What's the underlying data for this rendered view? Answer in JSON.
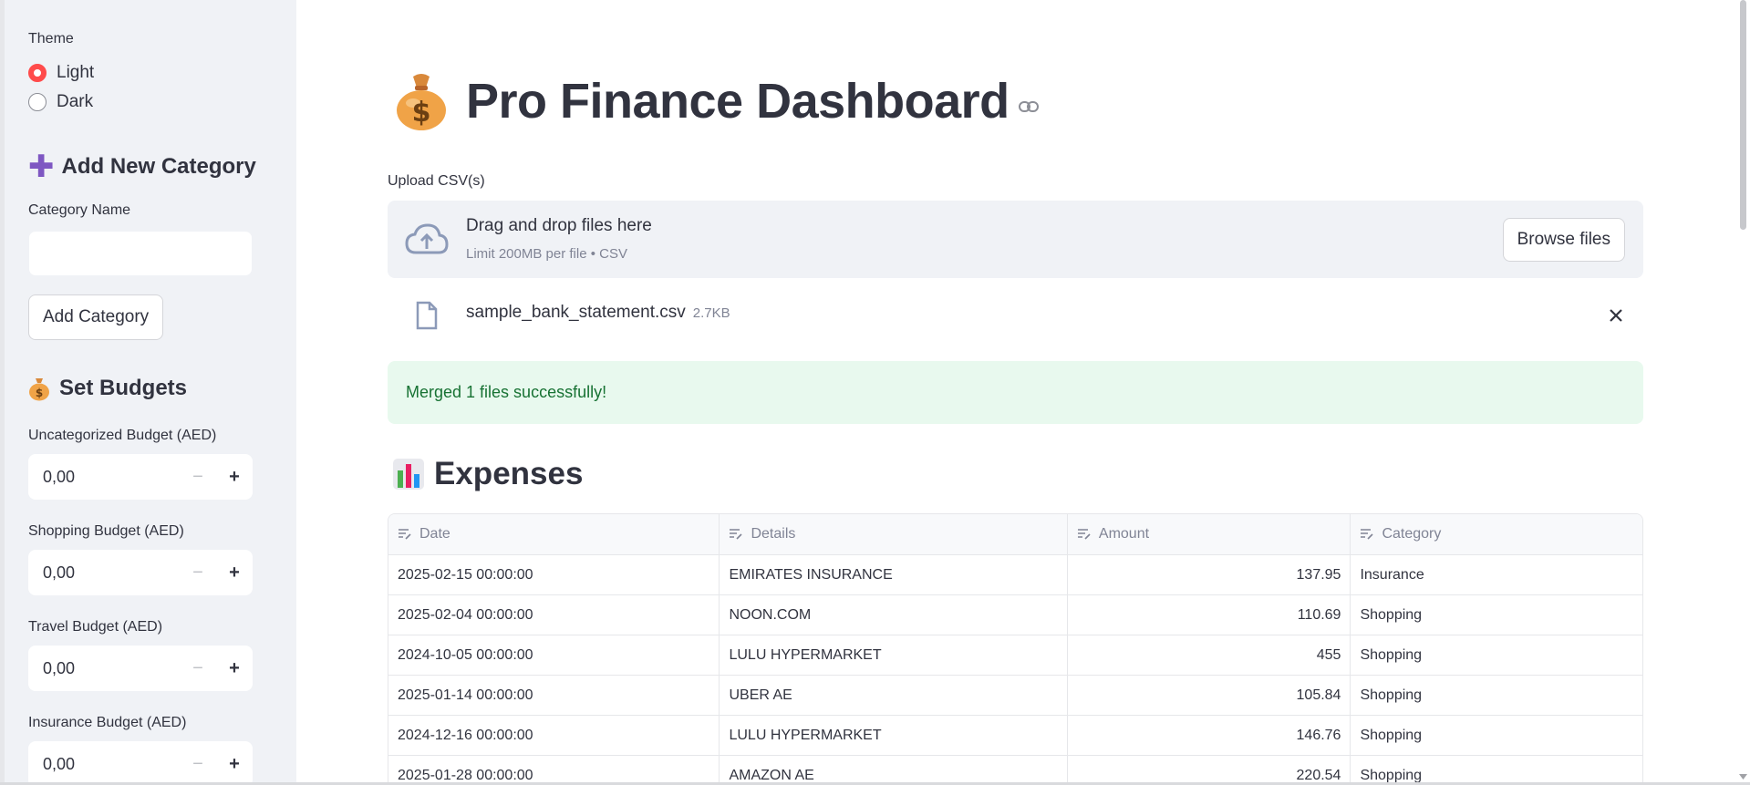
{
  "sidebar": {
    "theme_label": "Theme",
    "theme_options": [
      "Light",
      "Dark"
    ],
    "theme_selected": "Light",
    "add_category_heading": "Add New Category",
    "category_name_label": "Category Name",
    "category_name_value": "",
    "add_category_button": "Add Category",
    "set_budgets_heading": "Set Budgets",
    "budgets": [
      {
        "label": "Uncategorized Budget (AED)",
        "value": "0,00"
      },
      {
        "label": "Shopping Budget (AED)",
        "value": "0,00"
      },
      {
        "label": "Travel Budget (AED)",
        "value": "0,00"
      },
      {
        "label": "Insurance Budget (AED)",
        "value": "0,00"
      }
    ]
  },
  "main": {
    "title": "Pro Finance Dashboard",
    "upload_label": "Upload CSV(s)",
    "dropzone_title": "Drag and drop files here",
    "dropzone_sub": "Limit 200MB per file • CSV",
    "browse_button": "Browse files",
    "file": {
      "name": "sample_bank_statement.csv",
      "size": "2.7KB"
    },
    "alert": "Merged 1 files successfully!",
    "expenses_heading": "Expenses",
    "table": {
      "columns": [
        "Date",
        "Details",
        "Amount",
        "Category"
      ],
      "rows": [
        [
          "2025-02-15 00:00:00",
          "EMIRATES INSURANCE",
          "137.95",
          "Insurance"
        ],
        [
          "2025-02-04 00:00:00",
          "NOON.COM",
          "110.69",
          "Shopping"
        ],
        [
          "2024-10-05 00:00:00",
          "LULU HYPERMARKET",
          "455",
          "Shopping"
        ],
        [
          "2025-01-14 00:00:00",
          "UBER AE",
          "105.84",
          "Shopping"
        ],
        [
          "2024-12-16 00:00:00",
          "LULU HYPERMARKET",
          "146.76",
          "Shopping"
        ],
        [
          "2025-01-28 00:00:00",
          "AMAZON AE",
          "220.54",
          "Shopping"
        ]
      ]
    }
  },
  "colors": {
    "accent": "#ff4b4b",
    "success_bg": "#e8f9ee",
    "success_text": "#177233",
    "sidebar_bg": "#f0f2f6"
  }
}
